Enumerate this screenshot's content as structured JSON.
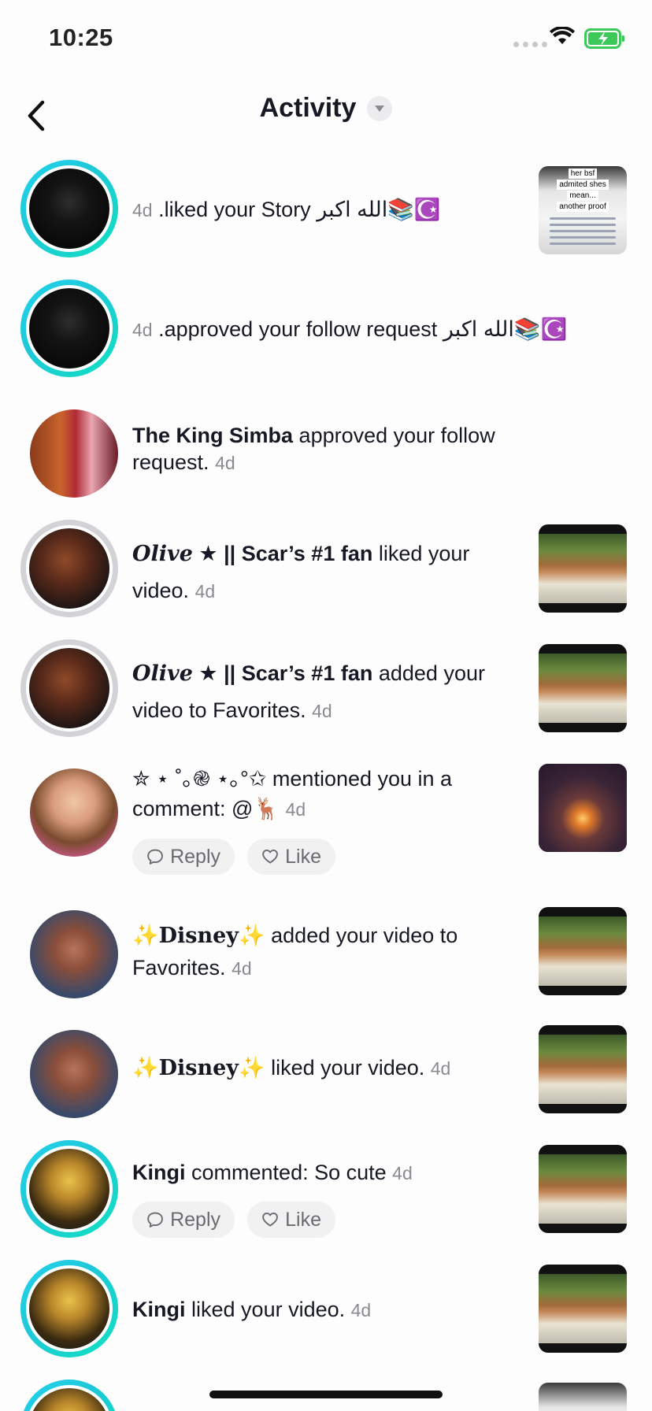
{
  "status_bar": {
    "time": "10:25"
  },
  "header": {
    "title": "Activity"
  },
  "actions": {
    "reply": "Reply",
    "like": "Like"
  },
  "items": [
    {
      "user": "",
      "prefix": "4d",
      "text": ".liked your Story الله اكبر📚☪️",
      "time": ""
    },
    {
      "user": "",
      "prefix": "4d",
      "text": ".approved your follow request الله اكبر📚☪️",
      "time": ""
    },
    {
      "user": "The King Simba",
      "text": "approved your follow request.",
      "time": "4d"
    },
    {
      "user_styled": "Olive",
      "user_rest": "★ || Scar’s #1 fan",
      "text": "liked your video.",
      "time": "4d"
    },
    {
      "user_styled": "Olive",
      "user_rest": "★ || Scar’s #1 fan",
      "text": "added your video to Favorites.",
      "time": "4d"
    },
    {
      "user": "✮ ⋆ ˚｡֎ ⋆｡°✩",
      "text": "mentioned you in a comment: @🦌",
      "time": "4d"
    },
    {
      "user_styled": "Disney",
      "sparkle": "✨",
      "text": "added your video to Favorites.",
      "time": "4d"
    },
    {
      "user_styled": "Disney",
      "sparkle": "✨",
      "text": "liked your video.",
      "time": "4d"
    },
    {
      "user": "Kingi",
      "text": "commented: So cute",
      "time": "4d"
    },
    {
      "user": "Kingi",
      "text": "liked your video.",
      "time": "4d"
    }
  ],
  "story_thumb": {
    "caption_lines": [
      "her bsf",
      "admited shes",
      "mean...",
      "another proof"
    ]
  }
}
